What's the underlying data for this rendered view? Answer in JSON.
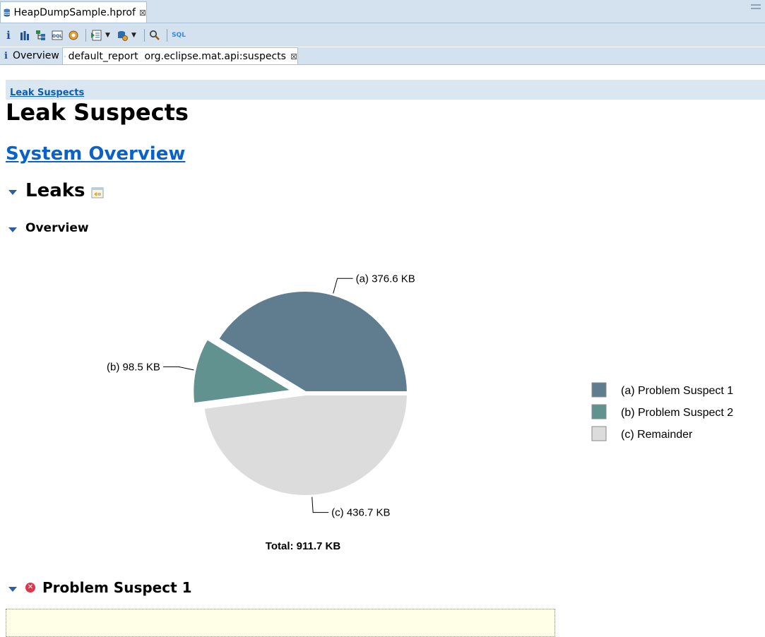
{
  "editor_tab": {
    "title": "HeapDumpSample.hprof",
    "close": "⊠"
  },
  "toolbar": {
    "icons": [
      "info-icon",
      "histogram-icon",
      "dominator-tree-icon",
      "oql-icon",
      "heap-dump-overview-icon",
      "reports-icon",
      "query-browser-icon",
      "search-icon",
      "sql-icon"
    ],
    "sql_label": "SQL"
  },
  "sub_tabs": {
    "overview_label": "Overview",
    "report_label": "default_report  org.eclipse.mat.api:suspects",
    "close": "⊠"
  },
  "breadcrumb": {
    "link": "Leak Suspects"
  },
  "page": {
    "title": "Leak Suspects",
    "system_overview_link": "System Overview",
    "leaks_heading": "Leaks",
    "overview_heading": "Overview",
    "problem_suspect_heading": "Problem Suspect 1"
  },
  "colors": {
    "slice_a": "#607d8f",
    "slice_b": "#62928f",
    "slice_c": "#dcdcdc",
    "link": "#0a62c8",
    "toolbar_bg": "#d4e2f0"
  },
  "chart_data": {
    "type": "pie",
    "slices": [
      {
        "key": "(a)",
        "name": "Problem Suspect 1",
        "value": 376.6,
        "label": "376.6 KB",
        "exploded": false
      },
      {
        "key": "(b)",
        "name": "Problem Suspect 2",
        "value": 98.5,
        "label": "98.5 KB",
        "exploded": true
      },
      {
        "key": "(c)",
        "name": "Remainder",
        "value": 436.7,
        "label": "436.7 KB",
        "exploded": false
      }
    ],
    "total_label": "Total: 911.7 KB",
    "legend_position": "right"
  }
}
